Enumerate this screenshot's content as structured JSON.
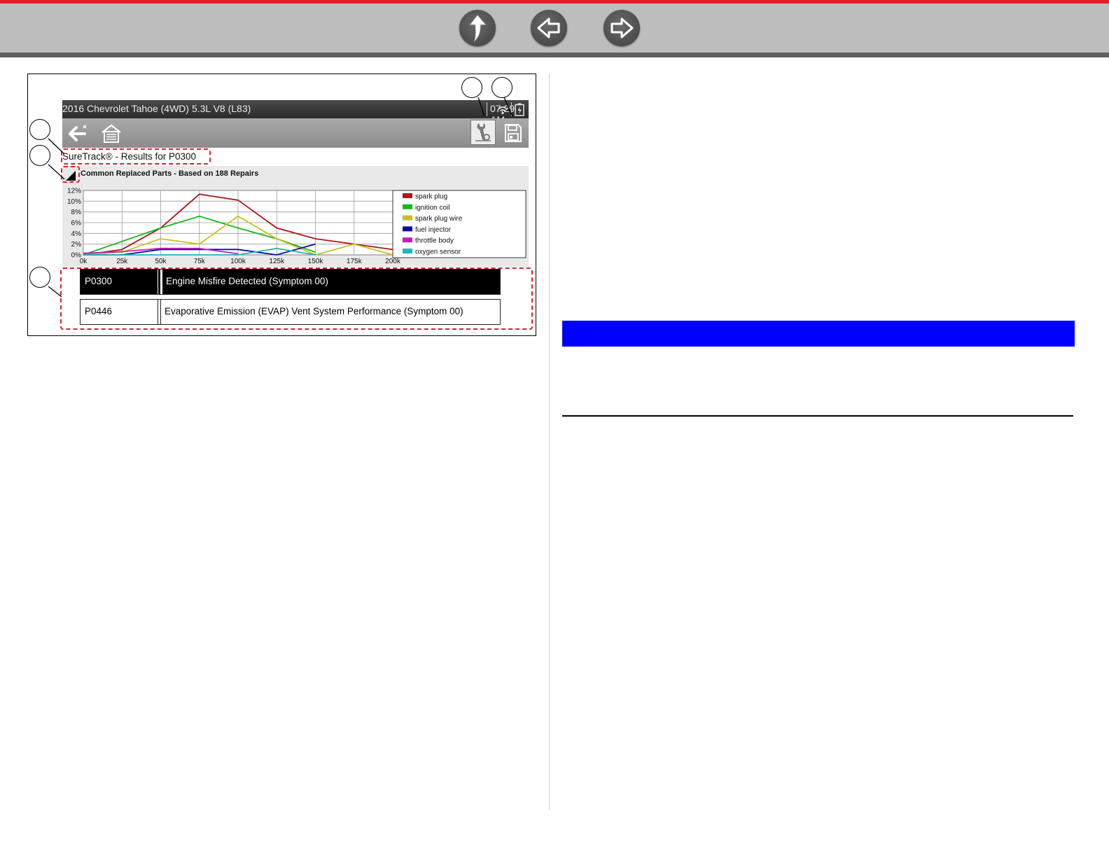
{
  "nav": {
    "up_icon": "up-arrow-icon",
    "back_icon": "left-arrow-icon",
    "forward_icon": "right-arrow-icon"
  },
  "screen": {
    "vehicle": "2016 Chevrolet Tahoe (4WD) 5.3L V8 (L83)",
    "time": "07:29 AM",
    "status_icons": [
      "wifi-icon",
      "battery-icon"
    ],
    "toolbar_icons": [
      "back-icon",
      "home-icon",
      "repair-info-icon",
      "save-icon"
    ],
    "title": "SureTrack® - Results for P0300",
    "chart_heading": "Common Replaced Parts - Based on 188 Repairs"
  },
  "chart_data": {
    "type": "line",
    "title": "Common Replaced Parts - Based on 188 Repairs",
    "x": [
      "0k",
      "25k",
      "50k",
      "75k",
      "100k",
      "125k",
      "150k",
      "175k",
      "200k"
    ],
    "xlim": [
      0,
      200
    ],
    "ylim": [
      0,
      12
    ],
    "y_ticks": [
      "0%",
      "2%",
      "4%",
      "6%",
      "8%",
      "10%",
      "12%"
    ],
    "grid": true,
    "legend_position": "right",
    "series": [
      {
        "name": "spark plug",
        "color": "#b0141c",
        "values": [
          0,
          1,
          5,
          11.3,
          10.2,
          5,
          3,
          2,
          1
        ]
      },
      {
        "name": "ignition coil",
        "color": "#16b81c",
        "values": [
          0,
          2.5,
          5,
          7.2,
          5,
          3,
          0.5,
          null,
          null
        ]
      },
      {
        "name": "spark plug wire",
        "color": "#c8c020",
        "values": [
          0,
          0.5,
          3,
          2,
          7.2,
          3,
          0,
          2,
          0
        ]
      },
      {
        "name": "fuel injector",
        "color": "#0c0ca8",
        "values": [
          0,
          0,
          1,
          1,
          1,
          0,
          2,
          null,
          null
        ]
      },
      {
        "name": "throttle body",
        "color": "#c020c0",
        "values": [
          0.3,
          0.6,
          1.2,
          1.2,
          0.2,
          null,
          null,
          null,
          null
        ]
      },
      {
        "name": "oxygen sensor",
        "color": "#20b8b8",
        "values": [
          0,
          0,
          0,
          0,
          0,
          1.2,
          0,
          null,
          null
        ]
      }
    ]
  },
  "dtcs": [
    {
      "code": "P0300",
      "description": "Engine Misfire Detected (Symptom 00)",
      "selected": true
    },
    {
      "code": "P0446",
      "description": "Evaporative Emission (EVAP) Vent System Performance (Symptom 00)",
      "selected": false
    }
  ],
  "colors": {
    "accent_red": "#e0202a",
    "bar_blue": "#0000ff",
    "topbar_gray": "#bdbdbd"
  }
}
